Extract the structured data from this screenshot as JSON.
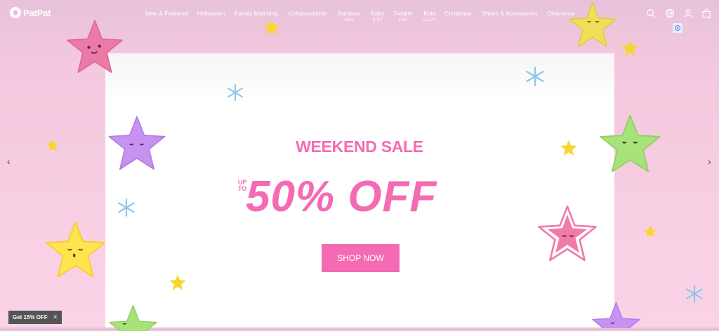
{
  "brand": {
    "logo_text": "PatPat"
  },
  "nav": [
    {
      "label": "New & Featured",
      "sub": ""
    },
    {
      "label": "Halloween",
      "sub": ""
    },
    {
      "label": "Family Matching",
      "sub": ""
    },
    {
      "label": "Collaborations",
      "sub": ""
    },
    {
      "label": "Bamboo",
      "sub": "New"
    },
    {
      "label": "Baby",
      "sub": "0-3Y"
    },
    {
      "label": "Toddler",
      "sub": "2-6Y"
    },
    {
      "label": "Kids",
      "sub": "5-12Y"
    },
    {
      "label": "Christmas",
      "sub": ""
    },
    {
      "label": "Shoes & Accessories",
      "sub": ""
    },
    {
      "label": "Clearance",
      "sub": ""
    }
  ],
  "header_icons": [
    "search-icon",
    "globe-icon",
    "account-icon",
    "bag-icon"
  ],
  "banner": {
    "headline": "WEEKEND SALE",
    "upto_line1": "UP",
    "upto_line2": "TO",
    "discount": "50% OFF",
    "cta": "SHOP NOW"
  },
  "promo": {
    "label": "Get 15% OFF",
    "close": "×"
  },
  "carousel": {
    "prev": "‹",
    "next": "›"
  },
  "colors": {
    "accent": "#f56bb3",
    "background": "#fbd3e6"
  }
}
